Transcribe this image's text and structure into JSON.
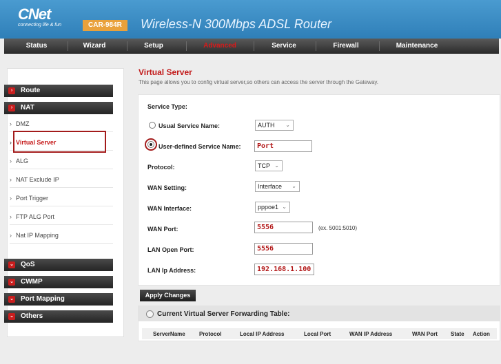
{
  "header": {
    "logo": "CNet",
    "tagline": "connecting life & fun",
    "model": "CAR-984R",
    "product": "Wireless-N 300Mbps ADSL Router"
  },
  "nav": {
    "items": [
      "Status",
      "Wizard",
      "Setup",
      "Advanced",
      "Service",
      "Firewall",
      "Maintenance"
    ],
    "active": "Advanced",
    "active_color": "#d91a1a"
  },
  "sidebar": {
    "route": "Route",
    "nat": "NAT",
    "sub": [
      "DMZ",
      "Virtual Server",
      "ALG",
      "NAT Exclude IP",
      "Port Trigger",
      "FTP ALG Port",
      "Nat IP Mapping"
    ],
    "active_sub": "Virtual Server",
    "qos": "QoS",
    "cwmp": "CWMP",
    "port_mapping": "Port Mapping",
    "others": "Others",
    "accent": "#c81e1e"
  },
  "main": {
    "title": "Virtual Server",
    "description": "This page allows you to config virtual server,so others can access the server through the Gateway.",
    "form": {
      "service_type_label": "Service Type:",
      "usual_service_label": "Usual Service Name:",
      "usual_service_value": "AUTH",
      "user_defined_label": "User-defined Service Name:",
      "user_defined_value": "Port",
      "protocol_label": "Protocol:",
      "protocol_value": "TCP",
      "wan_setting_label": "WAN Setting:",
      "wan_setting_value": "Interface",
      "wan_interface_label": "WAN Interface:",
      "wan_interface_value": "pppoe1",
      "wan_port_label": "WAN Port:",
      "wan_port_value": "5556",
      "wan_port_hint": "(ex. 5001:5010)",
      "lan_open_port_label": "LAN Open Port:",
      "lan_open_port_value": "5556",
      "lan_ip_label": "LAN Ip Address:",
      "lan_ip_value": "192.168.1.100"
    },
    "apply_label": "Apply Changes",
    "table": {
      "title": "Current Virtual Server Forwarding Table:",
      "columns": [
        "ServerName",
        "Protocol",
        "Local IP Address",
        "Local Port",
        "WAN IP Address",
        "WAN Port",
        "State",
        "Action"
      ]
    }
  }
}
